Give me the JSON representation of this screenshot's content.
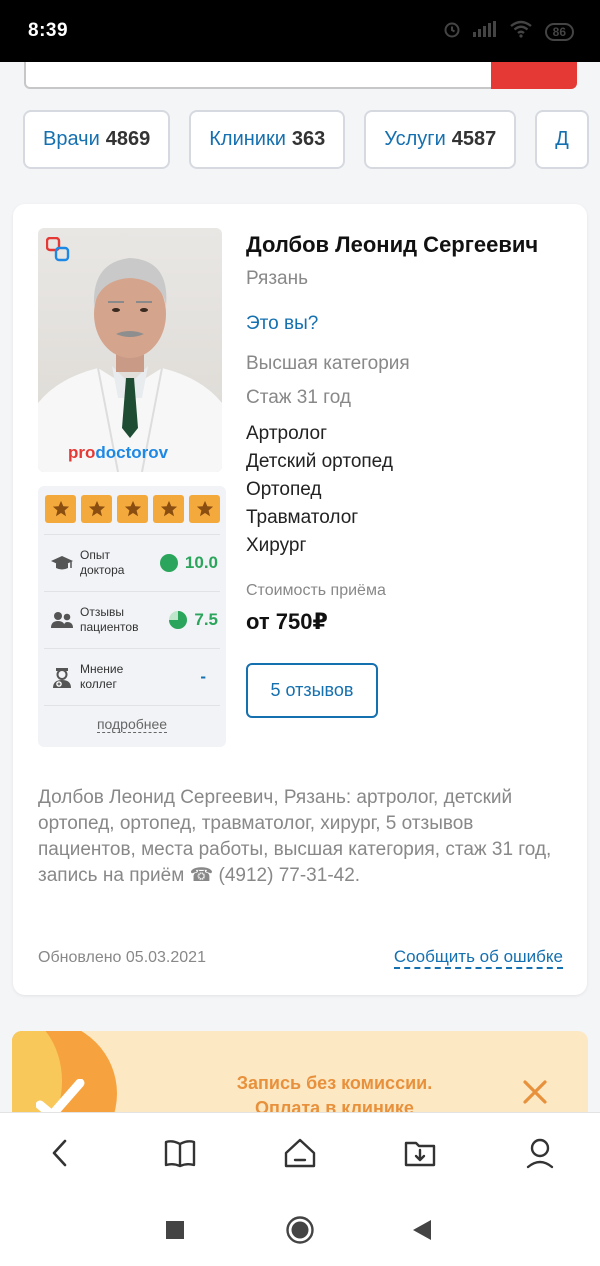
{
  "status_bar": {
    "time": "8:39",
    "battery": "86",
    "icons": [
      "alarm-icon",
      "signal-icon",
      "wifi-icon",
      "battery-icon"
    ]
  },
  "tabs": [
    {
      "label": "Врачи",
      "count": "4869"
    },
    {
      "label": "Клиники",
      "count": "363"
    },
    {
      "label": "Услуги",
      "count": "4587"
    },
    {
      "label": "Д",
      "count": ""
    }
  ],
  "card": {
    "photo_brand_pro": "pro",
    "photo_brand_doc": "doctorov",
    "name": "Долбов Леонид Сергеевич",
    "city": "Рязань",
    "is_you_link": "Это вы?",
    "category": "Высшая категория",
    "experience": "Стаж 31 год",
    "specialties": [
      "Артролог",
      "Детский ортопед",
      "Ортопед",
      "Травматолог",
      "Хирург"
    ],
    "price_label": "Стоимость приёма",
    "price_value": "от 750₽",
    "reviews_button": "5 отзывов",
    "rating": {
      "stars": 5,
      "rows": [
        {
          "label_line1": "Опыт",
          "label_line2": "доктора",
          "score": "10.0",
          "icon": "graduation-cap-icon",
          "fill": 1.0
        },
        {
          "label_line1": "Отзывы",
          "label_line2": "пациентов",
          "score": "7.5",
          "icon": "users-icon",
          "fill": 0.75
        },
        {
          "label_line1": "Мнение",
          "label_line2": "коллег",
          "score": "-",
          "icon": "doctor-icon",
          "fill": 0
        }
      ],
      "more_link": "подробнее"
    },
    "description": "Долбов Леонид Сергеевич, Рязань: артролог, детский ортопед, ортопед, травматолог, хирург, 5 отзывов пациентов, места работы, высшая категория, стаж 31 год, запись на приём ☎ (4912) 77-31-42.",
    "updated": "Обновлено 05.03.2021",
    "report_link": "Сообщить об ошибке"
  },
  "promo": {
    "line1": "Запись без комиссии.",
    "line2": "Оплата в клинике"
  },
  "browser_bar": {
    "buttons": [
      "back-icon",
      "bookmarks-icon",
      "home-icon",
      "downloads-icon",
      "profile-icon"
    ]
  },
  "nav_bar": {
    "buttons": [
      "recent-apps-icon",
      "home-icon",
      "back-icon"
    ]
  },
  "colors": {
    "accent": "#1570b0",
    "star": "#f4a93c",
    "score_green": "#2aa55b",
    "promo_bg": "#fde8c4",
    "promo_text": "#e8913c",
    "search_button": "#e53935"
  }
}
